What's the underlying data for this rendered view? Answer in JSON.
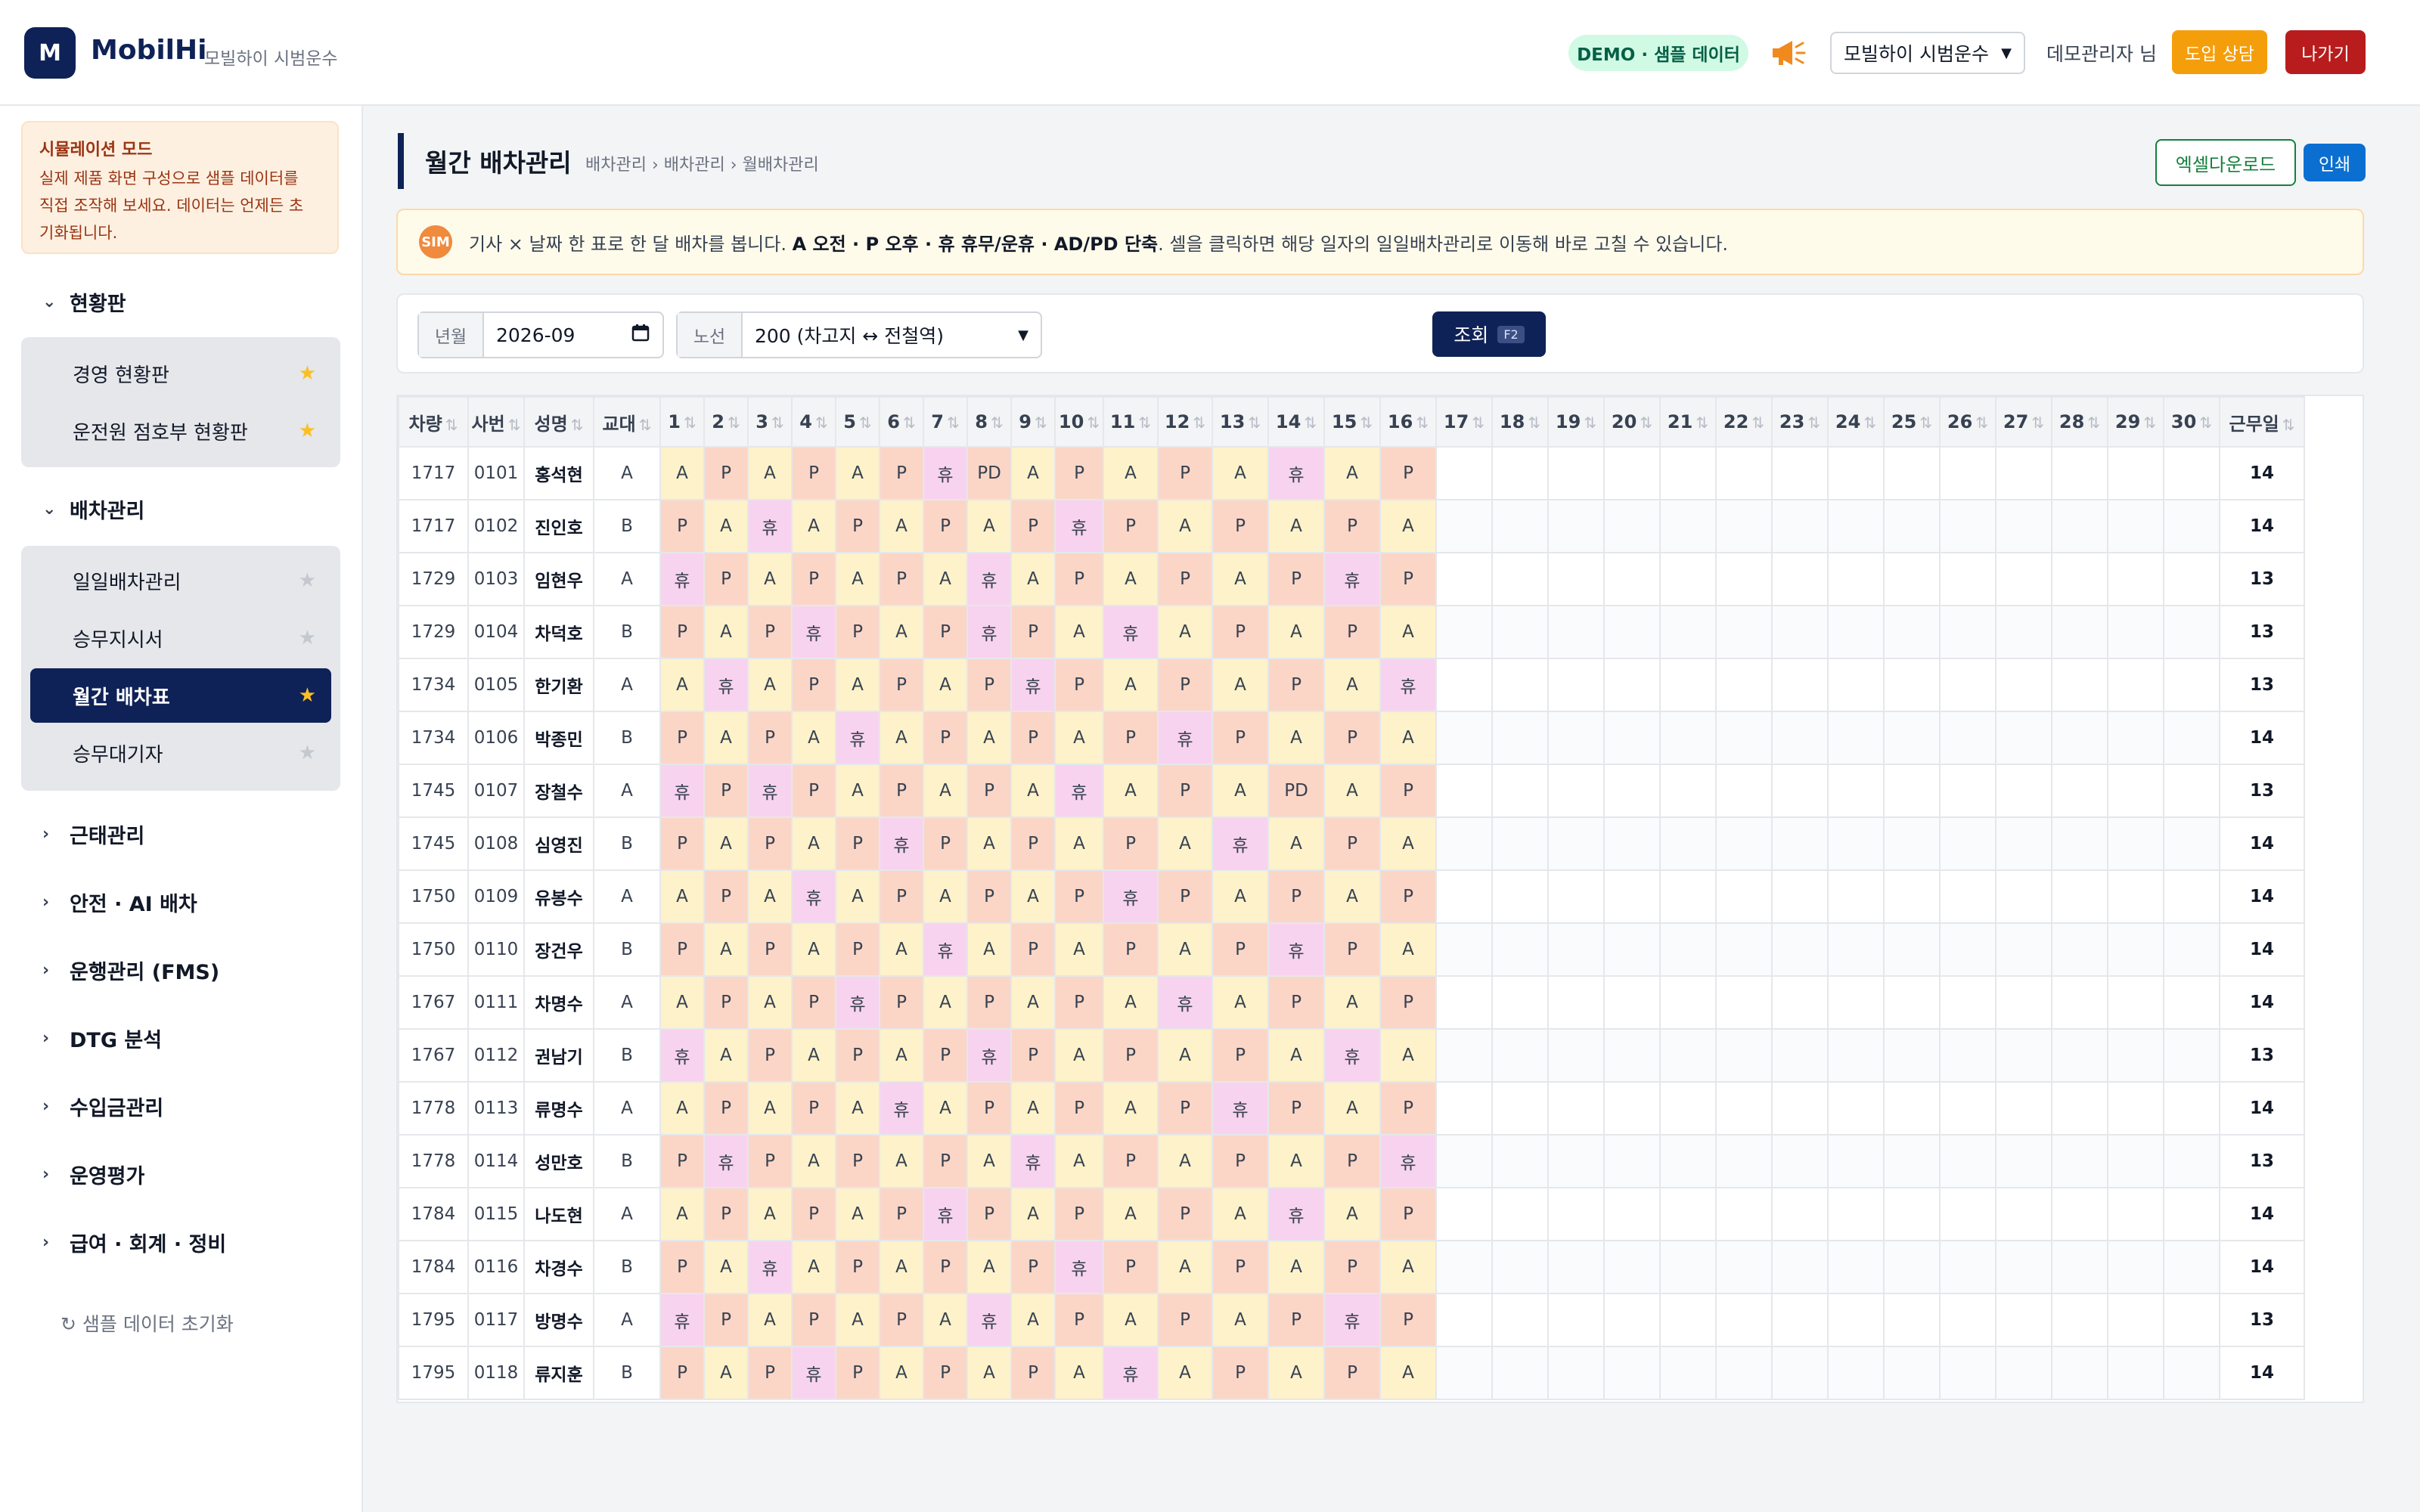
{
  "header": {
    "logo_letter": "M",
    "app_name": "MobilHi",
    "app_subtitle": "모빌하이 시범운수",
    "demo_badge": "DEMO · 샘플 데이터",
    "megaphone_icon": "megaphone-icon",
    "company_select": "모빌하이 시범운수",
    "user_label": "데모관리자 님",
    "consult_button": "도입 상담",
    "exit_button": "나가기"
  },
  "sidebar": {
    "sim_title": "시뮬레이션 모드",
    "sim_lines": [
      "실제 제품 화면 구성으로 샘플 데이터를",
      "직접 조작해 보세요. 데이터는 언제든 초",
      "기화됩니다."
    ],
    "sections": [
      {
        "label": "현황판",
        "expanded": true,
        "items": [
          {
            "label": "경영 현황판",
            "starred": true
          },
          {
            "label": "운전원 점호부 현황판",
            "starred": true
          }
        ]
      },
      {
        "label": "배차관리",
        "expanded": true,
        "items": [
          {
            "label": "일일배차관리",
            "starred": false
          },
          {
            "label": "승무지시서",
            "starred": false
          },
          {
            "label": "월간 배차표",
            "starred": true,
            "active": true
          },
          {
            "label": "승무대기자",
            "starred": false
          }
        ]
      },
      {
        "label": "근태관리",
        "expanded": false,
        "items": []
      },
      {
        "label": "안전 · AI 배차",
        "expanded": false,
        "items": []
      },
      {
        "label": "운행관리 (FMS)",
        "expanded": false,
        "items": []
      },
      {
        "label": "DTG 분석",
        "expanded": false,
        "items": []
      },
      {
        "label": "수입금관리",
        "expanded": false,
        "items": []
      },
      {
        "label": "운영평가",
        "expanded": false,
        "items": []
      },
      {
        "label": "급여 · 회계 · 정비",
        "expanded": false,
        "items": []
      }
    ],
    "reset_label": "샘플 데이터 초기화"
  },
  "main": {
    "title": "월간 배차관리",
    "breadcrumb": "배차관리 › 배차관리 › 월배차관리",
    "excel_button": "엑셀다운로드",
    "print_button": "인쇄",
    "notice": {
      "badge": "SIM",
      "pre": "기사 × 날짜 한 표로 한 달 배차를 봅니다. ",
      "bold": "A 오전 · P 오후 · 휴 휴무/운휴 · AD/PD 단축",
      "post": ". 셀을 클릭하면 해당 일자의 일일배차관리로 이동해 바로 고칠 수 있습니다."
    },
    "filters": {
      "month_label": "년월",
      "month_value": "2026-09",
      "route_label": "노선",
      "route_value": "200 (차고지 ↔ 전철역)",
      "query_button": "조회",
      "query_key": "F2"
    }
  },
  "table": {
    "columns": [
      "차량",
      "사번",
      "성명",
      "교대",
      "1",
      "2",
      "3",
      "4",
      "5",
      "6",
      "7",
      "8",
      "9",
      "10",
      "11",
      "12",
      "13",
      "14",
      "15",
      "16",
      "17",
      "18",
      "19",
      "20",
      "21",
      "22",
      "23",
      "24",
      "25",
      "26",
      "27",
      "28",
      "29",
      "30",
      "근무일"
    ],
    "sort_icon": "sort-arrows-icon",
    "rows": [
      {
        "car": "1717",
        "emp": "0101",
        "name": "홍석현",
        "shift": "A",
        "days": [
          "A",
          "P",
          "A",
          "P",
          "A",
          "P",
          "휴",
          "PD",
          "A",
          "P",
          "A",
          "P",
          "A",
          "휴",
          "A",
          "P"
        ],
        "total": "14"
      },
      {
        "car": "1717",
        "emp": "0102",
        "name": "진인호",
        "shift": "B",
        "days": [
          "P",
          "A",
          "휴",
          "A",
          "P",
          "A",
          "P",
          "A",
          "P",
          "휴",
          "P",
          "A",
          "P",
          "A",
          "P",
          "A"
        ],
        "total": "14"
      },
      {
        "car": "1729",
        "emp": "0103",
        "name": "임현우",
        "shift": "A",
        "days": [
          "휴",
          "P",
          "A",
          "P",
          "A",
          "P",
          "A",
          "휴",
          "A",
          "P",
          "A",
          "P",
          "A",
          "P",
          "휴",
          "P"
        ],
        "total": "13"
      },
      {
        "car": "1729",
        "emp": "0104",
        "name": "차덕호",
        "shift": "B",
        "days": [
          "P",
          "A",
          "P",
          "휴",
          "P",
          "A",
          "P",
          "휴",
          "P",
          "A",
          "휴",
          "A",
          "P",
          "A",
          "P",
          "A"
        ],
        "total": "13"
      },
      {
        "car": "1734",
        "emp": "0105",
        "name": "한기환",
        "shift": "A",
        "days": [
          "A",
          "휴",
          "A",
          "P",
          "A",
          "P",
          "A",
          "P",
          "휴",
          "P",
          "A",
          "P",
          "A",
          "P",
          "A",
          "휴"
        ],
        "total": "13"
      },
      {
        "car": "1734",
        "emp": "0106",
        "name": "박종민",
        "shift": "B",
        "days": [
          "P",
          "A",
          "P",
          "A",
          "휴",
          "A",
          "P",
          "A",
          "P",
          "A",
          "P",
          "휴",
          "P",
          "A",
          "P",
          "A"
        ],
        "total": "14"
      },
      {
        "car": "1745",
        "emp": "0107",
        "name": "장철수",
        "shift": "A",
        "days": [
          "휴",
          "P",
          "휴",
          "P",
          "A",
          "P",
          "A",
          "P",
          "A",
          "휴",
          "A",
          "P",
          "A",
          "PD",
          "A",
          "P"
        ],
        "total": "13"
      },
      {
        "car": "1745",
        "emp": "0108",
        "name": "심영진",
        "shift": "B",
        "days": [
          "P",
          "A",
          "P",
          "A",
          "P",
          "휴",
          "P",
          "A",
          "P",
          "A",
          "P",
          "A",
          "휴",
          "A",
          "P",
          "A"
        ],
        "total": "14"
      },
      {
        "car": "1750",
        "emp": "0109",
        "name": "유봉수",
        "shift": "A",
        "days": [
          "A",
          "P",
          "A",
          "휴",
          "A",
          "P",
          "A",
          "P",
          "A",
          "P",
          "휴",
          "P",
          "A",
          "P",
          "A",
          "P"
        ],
        "total": "14"
      },
      {
        "car": "1750",
        "emp": "0110",
        "name": "장건우",
        "shift": "B",
        "days": [
          "P",
          "A",
          "P",
          "A",
          "P",
          "A",
          "휴",
          "A",
          "P",
          "A",
          "P",
          "A",
          "P",
          "휴",
          "P",
          "A"
        ],
        "total": "14"
      },
      {
        "car": "1767",
        "emp": "0111",
        "name": "차명수",
        "shift": "A",
        "days": [
          "A",
          "P",
          "A",
          "P",
          "휴",
          "P",
          "A",
          "P",
          "A",
          "P",
          "A",
          "휴",
          "A",
          "P",
          "A",
          "P"
        ],
        "total": "14"
      },
      {
        "car": "1767",
        "emp": "0112",
        "name": "권남기",
        "shift": "B",
        "days": [
          "휴",
          "A",
          "P",
          "A",
          "P",
          "A",
          "P",
          "휴",
          "P",
          "A",
          "P",
          "A",
          "P",
          "A",
          "휴",
          "A"
        ],
        "total": "13"
      },
      {
        "car": "1778",
        "emp": "0113",
        "name": "류명수",
        "shift": "A",
        "days": [
          "A",
          "P",
          "A",
          "P",
          "A",
          "휴",
          "A",
          "P",
          "A",
          "P",
          "A",
          "P",
          "휴",
          "P",
          "A",
          "P"
        ],
        "total": "14"
      },
      {
        "car": "1778",
        "emp": "0114",
        "name": "성만호",
        "shift": "B",
        "days": [
          "P",
          "휴",
          "P",
          "A",
          "P",
          "A",
          "P",
          "A",
          "휴",
          "A",
          "P",
          "A",
          "P",
          "A",
          "P",
          "휴"
        ],
        "total": "13"
      },
      {
        "car": "1784",
        "emp": "0115",
        "name": "나도현",
        "shift": "A",
        "days": [
          "A",
          "P",
          "A",
          "P",
          "A",
          "P",
          "휴",
          "P",
          "A",
          "P",
          "A",
          "P",
          "A",
          "휴",
          "A",
          "P"
        ],
        "total": "14"
      },
      {
        "car": "1784",
        "emp": "0116",
        "name": "차경수",
        "shift": "B",
        "days": [
          "P",
          "A",
          "휴",
          "A",
          "P",
          "A",
          "P",
          "A",
          "P",
          "휴",
          "P",
          "A",
          "P",
          "A",
          "P",
          "A"
        ],
        "total": "14"
      },
      {
        "car": "1795",
        "emp": "0117",
        "name": "방명수",
        "shift": "A",
        "days": [
          "휴",
          "P",
          "A",
          "P",
          "A",
          "P",
          "A",
          "휴",
          "A",
          "P",
          "A",
          "P",
          "A",
          "P",
          "휴",
          "P"
        ],
        "total": "13"
      },
      {
        "car": "1795",
        "emp": "0118",
        "name": "류지훈",
        "shift": "B",
        "days": [
          "P",
          "A",
          "P",
          "휴",
          "P",
          "A",
          "P",
          "A",
          "P",
          "A",
          "휴",
          "A",
          "P",
          "A",
          "P",
          "A"
        ],
        "total": "14"
      }
    ]
  },
  "colors": {
    "navy": "#0f2257",
    "am_cell": "#fdf2c9",
    "pm_cell": "#fbd6c6",
    "off_cell": "#f8d3f0",
    "demo_badge_bg": "#d1fae5",
    "consult": "#f59e0b",
    "exit": "#b91c1c",
    "excel": "#15803d",
    "print": "#0a6fd0"
  }
}
